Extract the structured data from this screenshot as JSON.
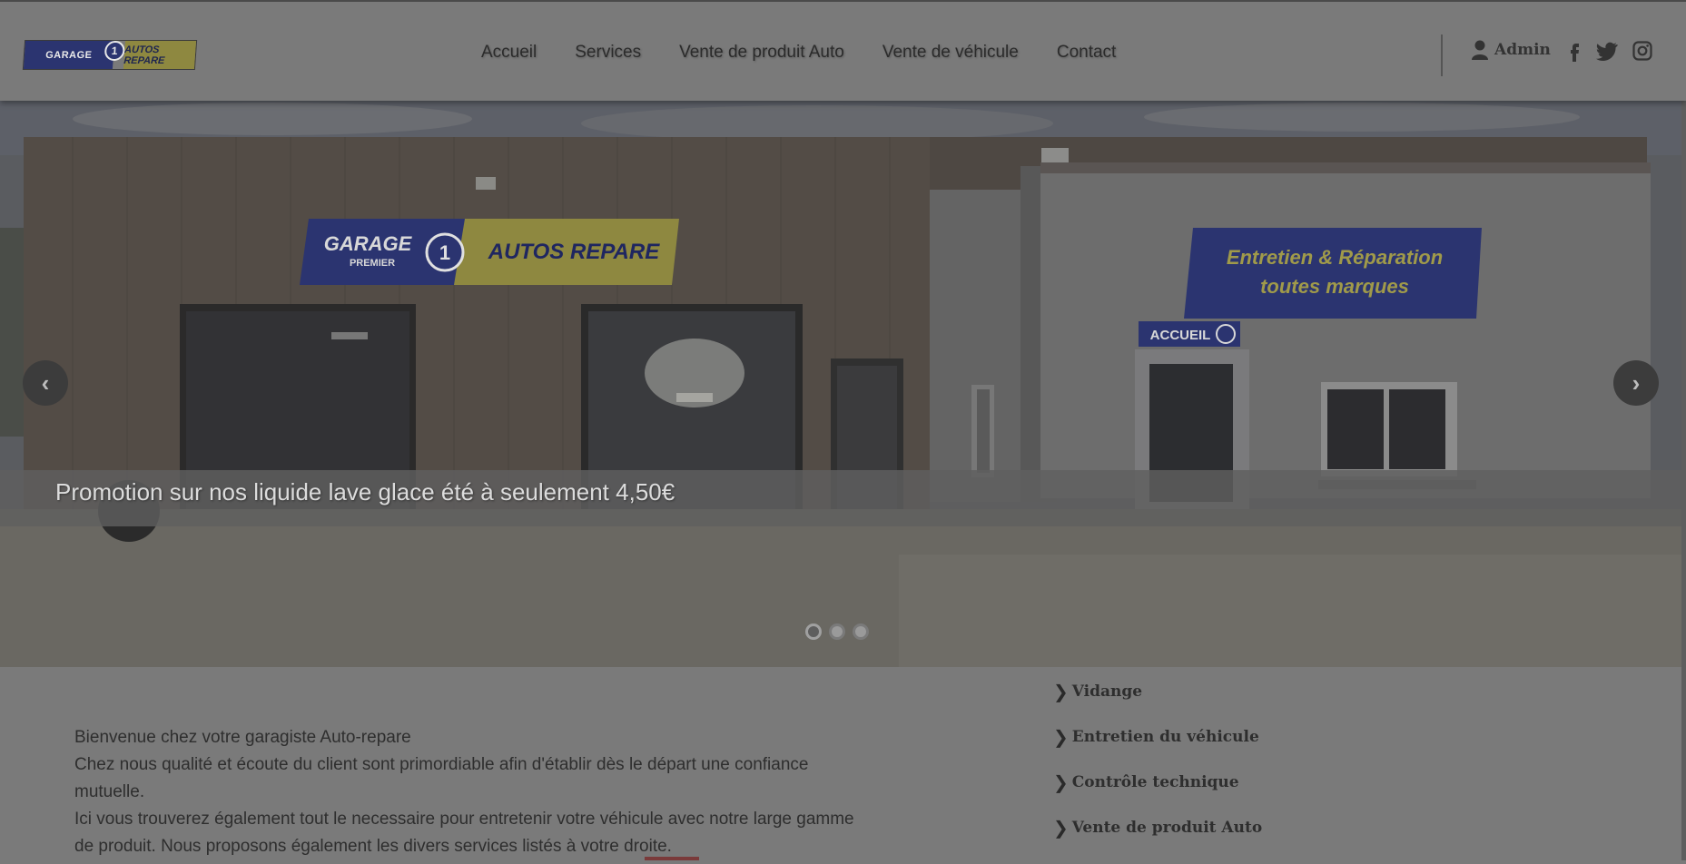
{
  "header": {
    "logo": {
      "left_text": "GARAGE",
      "sub_text": "PREMIER",
      "number": "1",
      "right_text": "AUTOS REPARE"
    },
    "nav": [
      {
        "label": "Accueil"
      },
      {
        "label": "Services"
      },
      {
        "label": "Vente de produit Auto"
      },
      {
        "label": "Vente de véhicule"
      },
      {
        "label": "Contact"
      }
    ],
    "admin_label": "Admin",
    "social": [
      "facebook-icon",
      "twitter-icon",
      "instagram-icon"
    ]
  },
  "hero": {
    "caption": "Promotion sur nos liquide lave glace été à seulement 4,50€",
    "sign_garage_left": "GARAGE",
    "sign_garage_sub": "PREMIER",
    "sign_garage_right": "AUTOS REPARE",
    "sign_entretien_line1": "Entretien & Réparation",
    "sign_entretien_line2": "toutes marques",
    "sign_accueil": "ACCUEIL",
    "slides_count": 3,
    "active_slide": 1
  },
  "intro": {
    "line1": "Bienvenue chez votre garagiste Auto-repare",
    "line2": "Chez nous qualité et écoute du client sont primordiable afin d'établir dès le départ une confiance mutuelle.",
    "line3": "Ici vous trouverez également tout le necessaire pour entretenir votre véhicule avec notre large gamme de produit. Nous proposons également les divers services listés à votre droite."
  },
  "services": [
    {
      "label": "Vidange"
    },
    {
      "label": "Entretien du véhicule"
    },
    {
      "label": "Contrôle technique"
    },
    {
      "label": "Vente de produit Auto"
    }
  ],
  "colors": {
    "overlay_gray": "#7a7a7a",
    "brand_blue": "#2b3470",
    "brand_yellow": "#8e8840"
  }
}
